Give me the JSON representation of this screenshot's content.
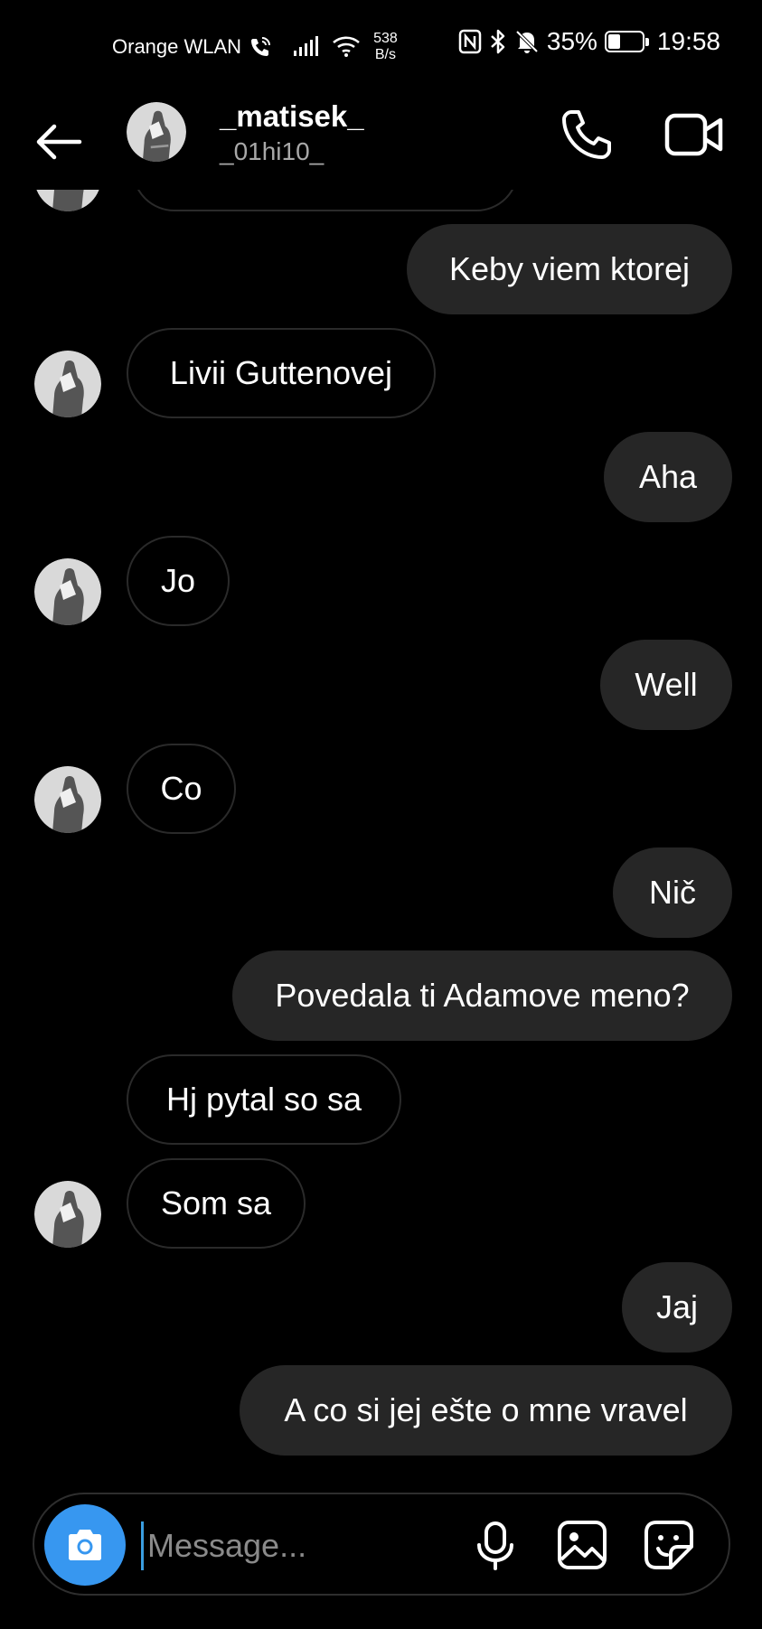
{
  "status_bar": {
    "carrier": "Orange WLAN",
    "net_speed_value": "538",
    "net_speed_unit": "B/s",
    "battery_percent": "35%",
    "battery_level": 0.35,
    "time": "19:58",
    "icons": [
      "wifi-call-icon",
      "signal-icon",
      "wifi-icon",
      "nfc-icon",
      "bluetooth-icon",
      "mute-icon",
      "battery-icon"
    ]
  },
  "header": {
    "name": "_matisek_",
    "username": "_01hi10_",
    "icons": [
      "back-arrow-icon",
      "avatar",
      "phone-icon",
      "video-icon"
    ]
  },
  "messages": [
    {
      "dir": "out",
      "text": "Keby viem ktorej"
    },
    {
      "dir": "in",
      "text": "Livii Guttenovej",
      "avatar": true
    },
    {
      "dir": "out",
      "text": "Aha"
    },
    {
      "dir": "in",
      "text": "Jo",
      "avatar": true
    },
    {
      "dir": "out",
      "text": "Well"
    },
    {
      "dir": "in",
      "text": "Co",
      "avatar": true
    },
    {
      "dir": "out",
      "text": "Nič"
    },
    {
      "dir": "out",
      "text": "Povedala ti Adamove meno?"
    },
    {
      "dir": "in",
      "text": "Hj pytal so sa",
      "avatar": false
    },
    {
      "dir": "in",
      "text": "Som sa",
      "avatar": true
    },
    {
      "dir": "out",
      "text": "Jaj"
    },
    {
      "dir": "out",
      "text": "A co si jej ešte o mne vravel"
    }
  ],
  "composer": {
    "placeholder": "Message...",
    "value": "",
    "icons": [
      "camera-icon",
      "microphone-icon",
      "gallery-icon",
      "sticker-icon"
    ]
  },
  "colors": {
    "background": "#000000",
    "outgoing_bubble": "#262626",
    "incoming_border": "#2a2a2a",
    "camera_button": "#3797f0",
    "username": "#a8a8a8"
  }
}
